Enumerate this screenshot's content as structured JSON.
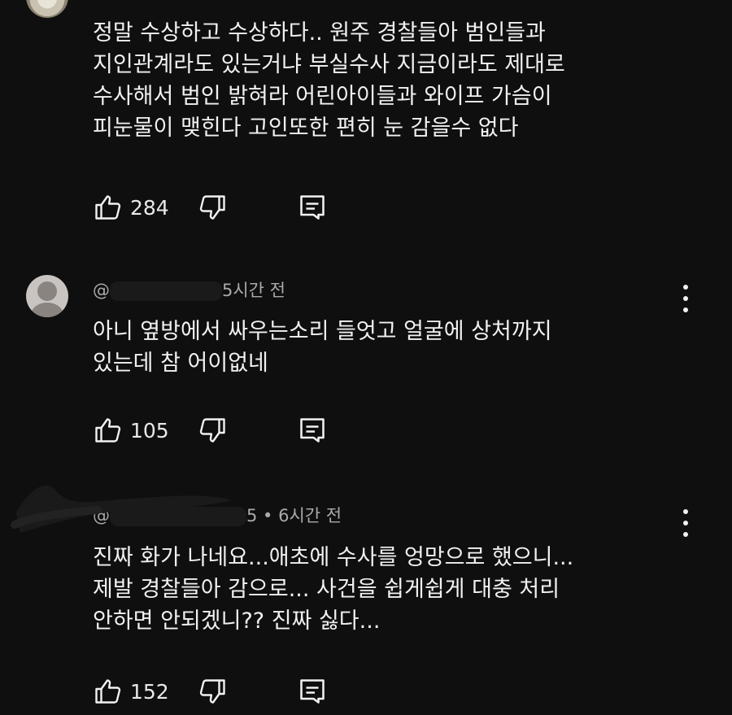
{
  "comments": [
    {
      "header": "",
      "text": "정말 수상하고 수상하다.. 원주 경찰들아 범인들과\n지인관계라도 있는거냐 부실수사 지금이라도 제대로\n수사해서 범인 밝혀라 어린아이들과 와이프 가슴이\n피눈물이 맺힌다 고인또한 편히 눈 감을수 없다",
      "likes": "284"
    },
    {
      "header_prefix": "@",
      "header_time": "5시간 전",
      "text": "아니 옆방에서 싸우는소리 들엇고 얼굴에 상처까지\n있는데 참  어이없네",
      "likes": "105"
    },
    {
      "header_prefix": "@",
      "header_time": "5 • 6시간 전",
      "text": "진짜 화가 나네요...애초에 수사를 엉망으로 했으니...\n제발 경찰들아 감으로... 사건을 쉽게쉽게 대충 처리\n안하면 안되겠니?? 진짜 싫다...",
      "likes": "152"
    }
  ],
  "icons": {
    "like": "thumbs-up-icon",
    "dislike": "thumbs-down-icon",
    "reply": "reply-icon",
    "more": "more-vert-icon"
  }
}
